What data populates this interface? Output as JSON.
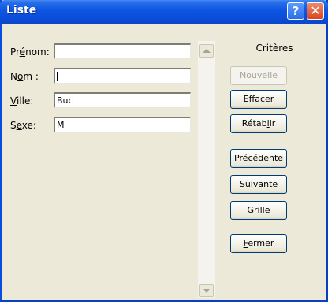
{
  "window": {
    "title": "Liste"
  },
  "title_buttons": {
    "help": "?",
    "close": "✕"
  },
  "fields": [
    {
      "label_pre": "Pr",
      "label_acc": "é",
      "label_post": "nom:",
      "value": ""
    },
    {
      "label_pre": "N",
      "label_acc": "o",
      "label_post": "m :",
      "value": ""
    },
    {
      "label_pre": "",
      "label_acc": "V",
      "label_post": "ille:",
      "value": "Buc"
    },
    {
      "label_pre": "S",
      "label_acc": "e",
      "label_post": "xe:",
      "value": "M"
    }
  ],
  "criteria_label": "Critères",
  "buttons": [
    {
      "pre": "",
      "acc": "",
      "post": "Nouvelle",
      "enabled": false
    },
    {
      "pre": "Effa",
      "acc": "c",
      "post": "er",
      "enabled": true
    },
    {
      "pre": "Rétab",
      "acc": "l",
      "post": "ir",
      "enabled": true
    },
    {
      "pre": "",
      "acc": "P",
      "post": "récédente",
      "enabled": true
    },
    {
      "pre": "S",
      "acc": "u",
      "post": "ivante",
      "enabled": true
    },
    {
      "pre": "",
      "acc": "G",
      "post": "rille",
      "enabled": true
    },
    {
      "pre": "",
      "acc": "F",
      "post": "ermer",
      "enabled": true
    }
  ]
}
